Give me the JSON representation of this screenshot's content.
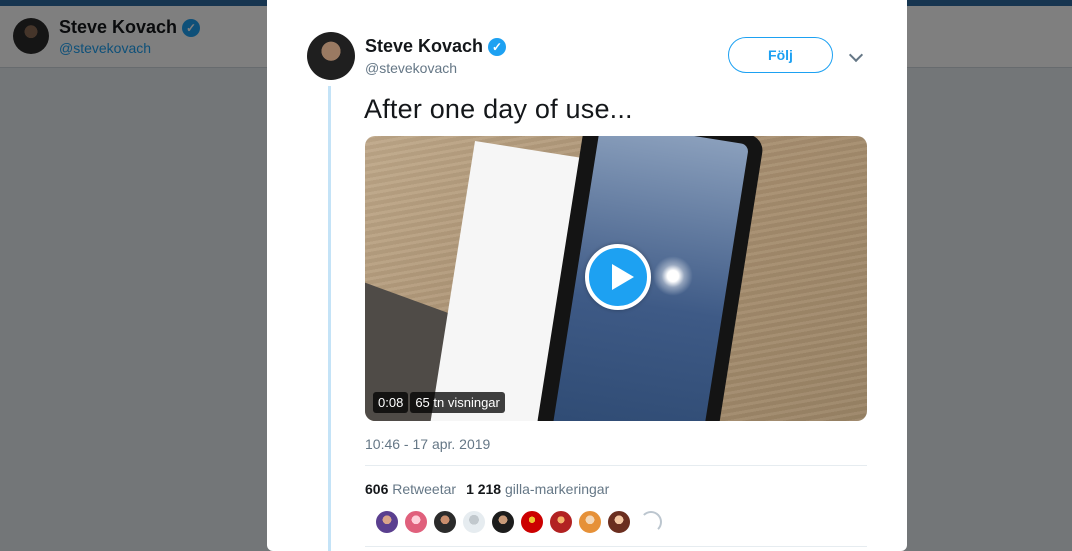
{
  "background_header": {
    "name": "Steve Kovach",
    "handle": "@stevekovach"
  },
  "tweet": {
    "author_name": "Steve Kovach",
    "author_handle": "@stevekovach",
    "follow_label": "Följ",
    "text": "After one day of use...",
    "timestamp": "10:46 - 17 apr. 2019",
    "video": {
      "duration": "0:08",
      "views": "65 tn visningar"
    },
    "stats": {
      "retweets_count": "606",
      "retweets_label": "Retweetar",
      "likes_count": "1 218",
      "likes_label": "gilla-markeringar"
    },
    "likers_count": 9
  },
  "colors": {
    "accent": "#1da1f2",
    "thread_line": "#c4e3f7",
    "secondary_text": "#657786"
  },
  "icons": [
    "verified-badge-icon",
    "chevron-down-icon",
    "play-icon",
    "loading-spinner-icon"
  ]
}
